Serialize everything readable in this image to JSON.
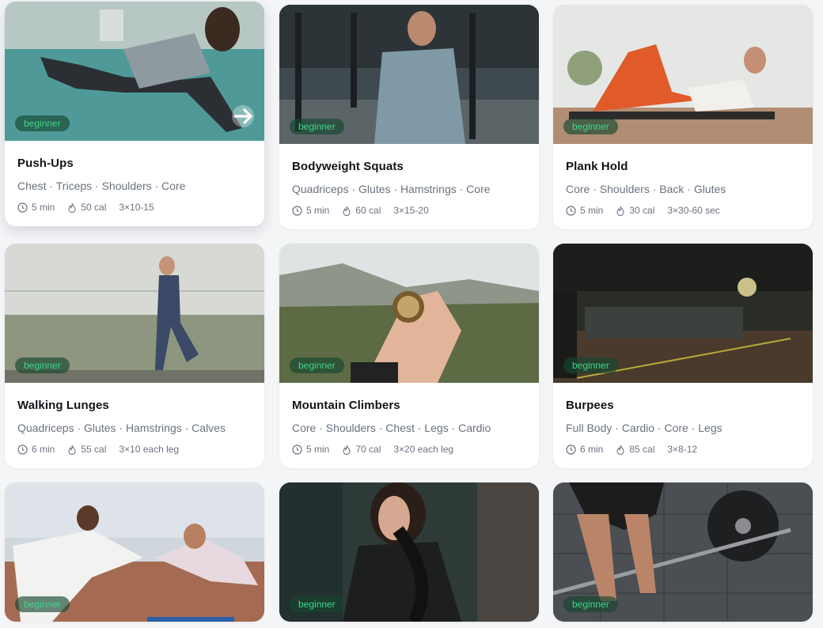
{
  "accent": "#3fd68a",
  "cards": [
    {
      "title": "Push-Ups",
      "muscles": "Chest · Triceps · Shoulders · Core",
      "level": "beginner",
      "duration": "5 min",
      "calories": "50 cal",
      "sets": "3×10-15"
    },
    {
      "title": "Bodyweight Squats",
      "muscles": "Quadriceps · Glutes · Hamstrings · Core",
      "level": "beginner",
      "duration": "5 min",
      "calories": "60 cal",
      "sets": "3×15-20"
    },
    {
      "title": "Plank Hold",
      "muscles": "Core · Shoulders · Back · Glutes",
      "level": "beginner",
      "duration": "5 min",
      "calories": "30 cal",
      "sets": "3×30-60 sec"
    },
    {
      "title": "Walking Lunges",
      "muscles": "Quadriceps · Glutes · Hamstrings · Calves",
      "level": "beginner",
      "duration": "6 min",
      "calories": "55 cal",
      "sets": "3×10 each leg"
    },
    {
      "title": "Mountain Climbers",
      "muscles": "Core · Shoulders · Chest · Legs · Cardio",
      "level": "beginner",
      "duration": "5 min",
      "calories": "70 cal",
      "sets": "3×20 each leg"
    },
    {
      "title": "Burpees",
      "muscles": "Full Body · Cardio · Core · Legs",
      "level": "beginner",
      "duration": "6 min",
      "calories": "85 cal",
      "sets": "3×8-12"
    },
    {
      "level": "beginner"
    },
    {
      "level": "beginner"
    },
    {
      "level": "beginner"
    }
  ]
}
